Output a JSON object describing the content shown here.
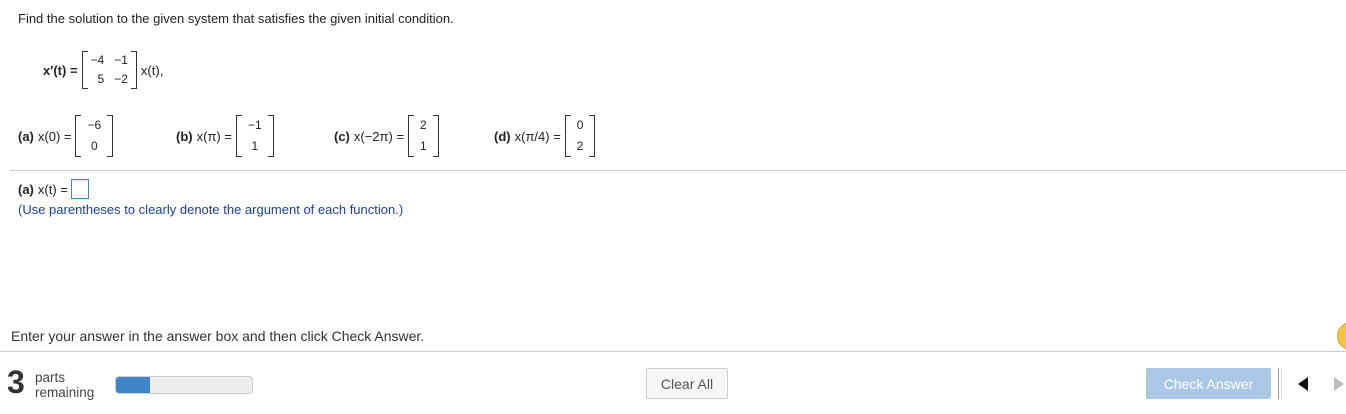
{
  "question": {
    "text": "Find the solution to the given system that satisfies the given initial condition.",
    "system": {
      "lhs": "x′(t) =",
      "matrix": [
        [
          "−4",
          "−1"
        ],
        [
          "5",
          "−2"
        ]
      ],
      "rhs": "x(t),"
    },
    "conditions": [
      {
        "label": "(a)",
        "expr": "x(0) =",
        "vector": [
          "−6",
          "0"
        ]
      },
      {
        "label": "(b)",
        "expr": "x(π) =",
        "vector": [
          "−1",
          "1"
        ]
      },
      {
        "label": "(c)",
        "expr": "x(−2π) =",
        "vector": [
          "2",
          "1"
        ]
      },
      {
        "label": "(d)",
        "expr": "x(π/4) =",
        "vector": [
          "0",
          "2"
        ]
      }
    ]
  },
  "answer": {
    "label": "(a)",
    "expr": "x(t) =",
    "hint": "(Use parentheses to clearly denote the argument of each function.)"
  },
  "footer": {
    "instruction": "Enter your answer in the answer box and then click Check Answer.",
    "parts_count": "3",
    "parts_line1": "parts",
    "parts_line2": "remaining",
    "progress_fraction": 0.25,
    "clear_label": "Clear All",
    "check_label": "Check Answer"
  },
  "colors": {
    "accent": "#3e84c6",
    "hint": "#1b3f9e",
    "check_disabled": "#a9c8e3",
    "help": "#f4c443"
  },
  "icons": [
    "help-icon",
    "prev-arrow-icon",
    "next-arrow-icon"
  ]
}
